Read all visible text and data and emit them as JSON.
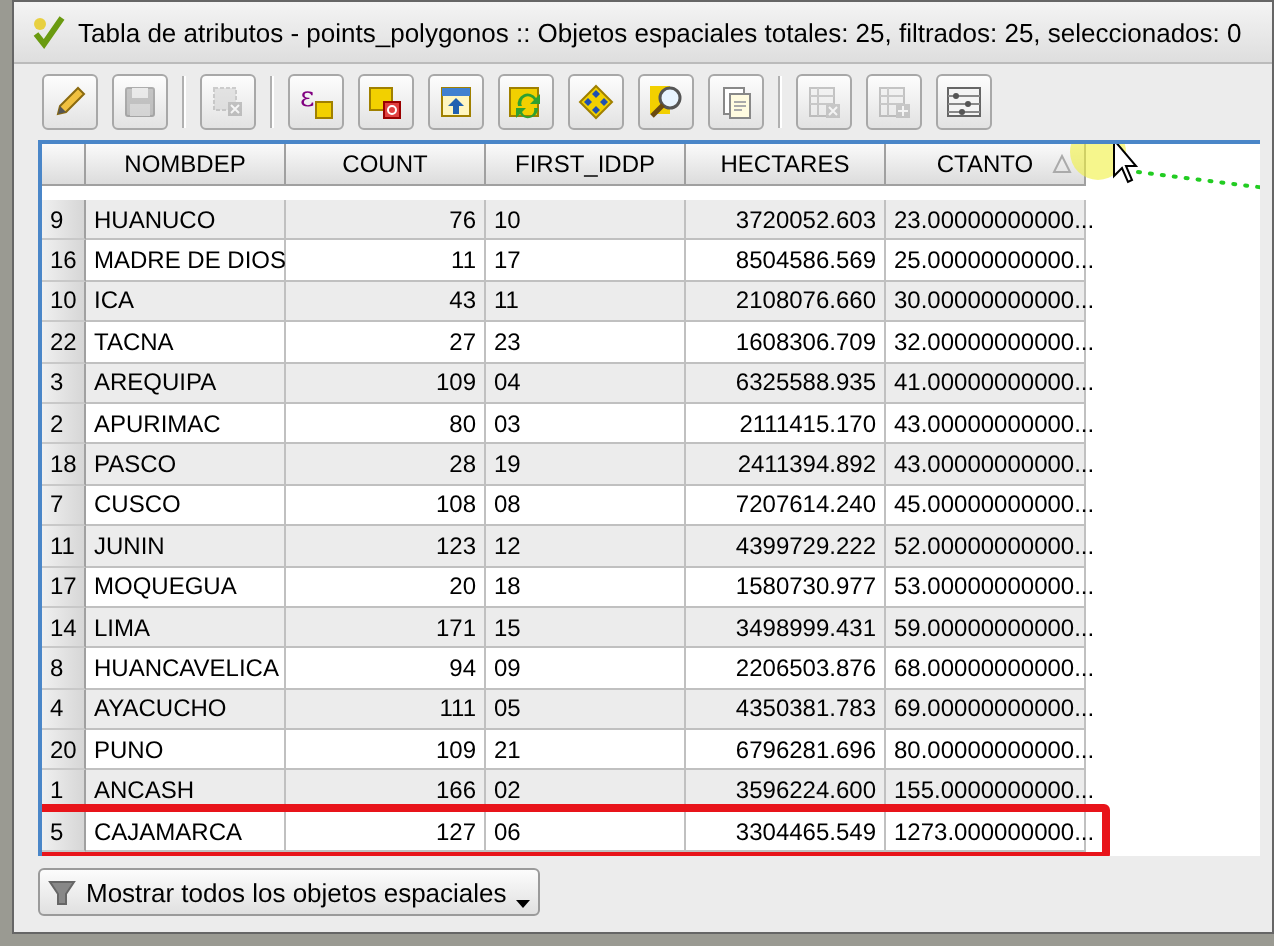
{
  "window": {
    "title": "Tabla de atributos - points_polygonos :: Objetos espaciales totales: 25, filtrados: 25, seleccionados: 0"
  },
  "toolbar": [
    {
      "kind": "pencil",
      "disabled": false
    },
    {
      "kind": "disk",
      "disabled": true
    },
    {
      "kind": "separator"
    },
    {
      "kind": "deselect",
      "disabled": true
    },
    {
      "kind": "separator"
    },
    {
      "kind": "expression",
      "symbol": "ε",
      "disabled": false
    },
    {
      "kind": "squares",
      "disabled": false
    },
    {
      "kind": "move-top",
      "disabled": false
    },
    {
      "kind": "invert",
      "disabled": false
    },
    {
      "kind": "pan",
      "disabled": false
    },
    {
      "kind": "zoom",
      "disabled": false
    },
    {
      "kind": "copy",
      "disabled": false
    },
    {
      "kind": "separator"
    },
    {
      "kind": "delete-column",
      "disabled": true
    },
    {
      "kind": "new-column",
      "disabled": true
    },
    {
      "kind": "calculator",
      "disabled": false
    }
  ],
  "table": {
    "columns": [
      {
        "label": "NOMBDEP",
        "sorted": false
      },
      {
        "label": "COUNT",
        "sorted": false
      },
      {
        "label": "FIRST_IDDP",
        "sorted": false
      },
      {
        "label": "HECTARES",
        "sorted": false
      },
      {
        "label": "CTANTO",
        "sorted": true
      }
    ],
    "rows": [
      {
        "index": "9",
        "cells": [
          "HUANUCO",
          "76",
          "10",
          "3720052.603",
          "23.00000000000..."
        ],
        "highlighted": false
      },
      {
        "index": "16",
        "cells": [
          "MADRE DE DIOS",
          "11",
          "17",
          "8504586.569",
          "25.00000000000..."
        ],
        "highlighted": false
      },
      {
        "index": "10",
        "cells": [
          "ICA",
          "43",
          "11",
          "2108076.660",
          "30.00000000000..."
        ],
        "highlighted": false
      },
      {
        "index": "22",
        "cells": [
          "TACNA",
          "27",
          "23",
          "1608306.709",
          "32.00000000000..."
        ],
        "highlighted": false
      },
      {
        "index": "3",
        "cells": [
          "AREQUIPA",
          "109",
          "04",
          "6325588.935",
          "41.00000000000..."
        ],
        "highlighted": false
      },
      {
        "index": "2",
        "cells": [
          "APURIMAC",
          "80",
          "03",
          "2111415.170",
          "43.00000000000..."
        ],
        "highlighted": false
      },
      {
        "index": "18",
        "cells": [
          "PASCO",
          "28",
          "19",
          "2411394.892",
          "43.00000000000..."
        ],
        "highlighted": false
      },
      {
        "index": "7",
        "cells": [
          "CUSCO",
          "108",
          "08",
          "7207614.240",
          "45.00000000000..."
        ],
        "highlighted": false
      },
      {
        "index": "11",
        "cells": [
          "JUNIN",
          "123",
          "12",
          "4399729.222",
          "52.00000000000..."
        ],
        "highlighted": false
      },
      {
        "index": "17",
        "cells": [
          "MOQUEGUA",
          "20",
          "18",
          "1580730.977",
          "53.00000000000..."
        ],
        "highlighted": false
      },
      {
        "index": "14",
        "cells": [
          "LIMA",
          "171",
          "15",
          "3498999.431",
          "59.00000000000..."
        ],
        "highlighted": false
      },
      {
        "index": "8",
        "cells": [
          "HUANCAVELICA",
          "94",
          "09",
          "2206503.876",
          "68.00000000000..."
        ],
        "highlighted": false
      },
      {
        "index": "4",
        "cells": [
          "AYACUCHO",
          "111",
          "05",
          "4350381.783",
          "69.00000000000..."
        ],
        "highlighted": false
      },
      {
        "index": "20",
        "cells": [
          "PUNO",
          "109",
          "21",
          "6796281.696",
          "80.00000000000..."
        ],
        "highlighted": false
      },
      {
        "index": "1",
        "cells": [
          "ANCASH",
          "166",
          "02",
          "3596224.600",
          "155.0000000000..."
        ],
        "highlighted": false
      },
      {
        "index": "5",
        "cells": [
          "CAJAMARCA",
          "127",
          "06",
          "3304465.549",
          "1273.000000000..."
        ],
        "highlighted": true
      }
    ]
  },
  "footer_button": {
    "label": "Mostrar todos los objetos espaciales"
  }
}
